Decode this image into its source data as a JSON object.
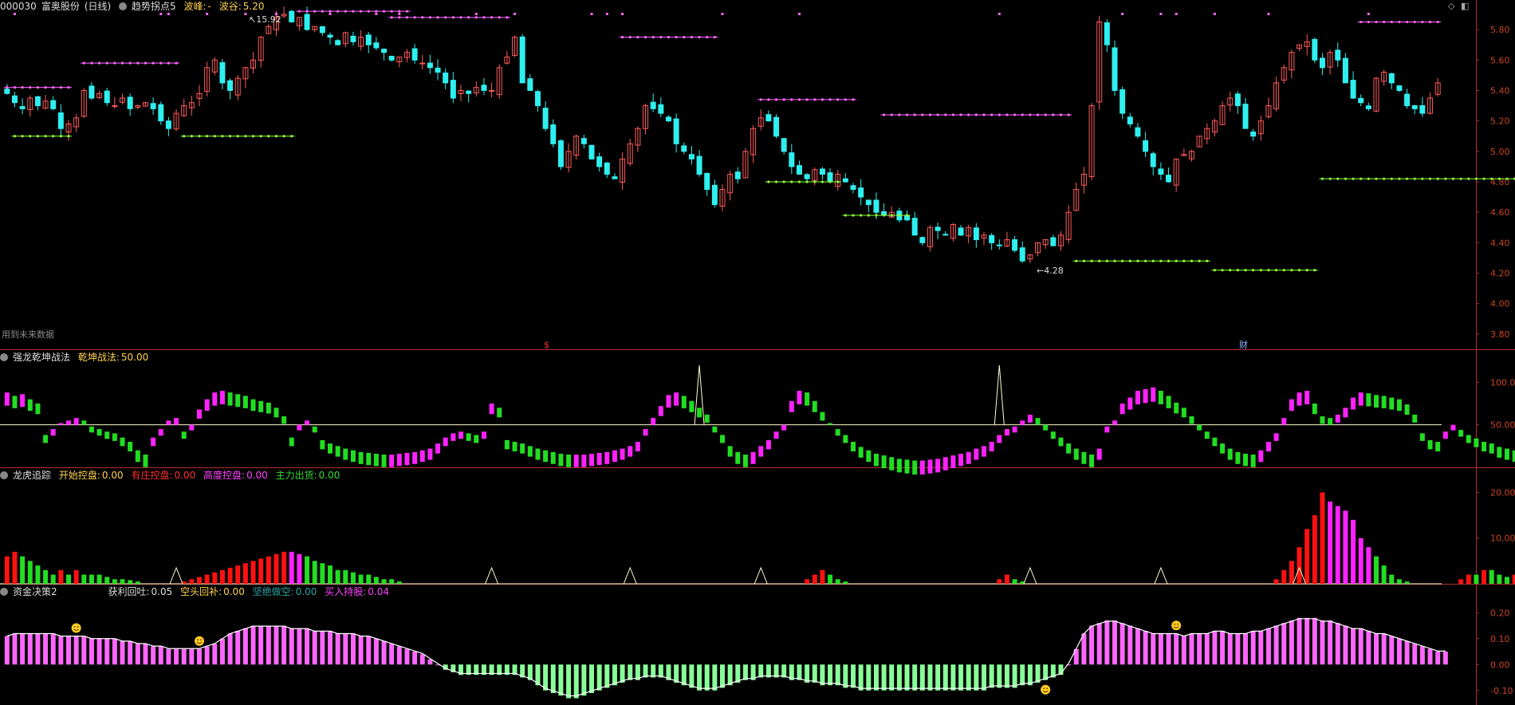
{
  "colors": {
    "up": "#ff5a5a",
    "down": "#2ff0f0",
    "resistance": "#ff66ff",
    "support": "#8dff3a",
    "ma": "#ffffcc",
    "green_bar": "#22dd22",
    "magenta_bar": "#ff22ff",
    "red_bar": "#ff1111",
    "light_green_bar": "#88ff99",
    "pink_bar": "#ff66ff",
    "axis": "#b03030"
  },
  "panel1": {
    "code": "000030",
    "name": "富奥股份",
    "period": "(日线)",
    "indicator": "趋势拐点5",
    "peak_label": "波峰:",
    "peak_value": "-",
    "valley_label": "波谷:",
    "valley_value": "5.20",
    "future_data_note": "用到未来数据",
    "s_marker": "$",
    "cai_marker": "财",
    "high_annotation": "15.92",
    "low_annotation": "4.28"
  },
  "panel2": {
    "name": "强龙乾坤战法",
    "field_label": "乾坤战法:",
    "field_value": "50.00"
  },
  "panel3": {
    "name": "龙虎追踪",
    "f1_label": "开始控盘:",
    "f1_value": "0.00",
    "f2_label": "有庄控盘:",
    "f2_value": "0.00",
    "f3_label": "高度控盘:",
    "f3_value": "0.00",
    "f4_label": "主力出货:",
    "f4_value": "0.00"
  },
  "panel4": {
    "name": "资金决策2",
    "f1_label": "获利回吐:",
    "f1_value": "0.05",
    "f2_label": "空头回补:",
    "f2_value": "0.00",
    "f3_label": "坚绝做空:",
    "f3_value": "0.00",
    "f4_label": "买入持股:",
    "f4_value": "0.04"
  },
  "chart_data": [
    {
      "type": "candlestick",
      "panel": "price",
      "ylim": [
        3.7,
        5.9
      ],
      "y_ticks": [
        "5.80",
        "5.60",
        "5.40",
        "5.20",
        "5.00",
        "4.80",
        "4.60",
        "4.40",
        "4.20",
        "4.00",
        "3.80"
      ],
      "close": [
        5.38,
        5.32,
        5.28,
        5.35,
        5.3,
        5.33,
        5.28,
        5.15,
        5.18,
        5.22,
        5.4,
        5.35,
        5.38,
        5.32,
        5.3,
        5.35,
        5.28,
        5.3,
        5.32,
        5.28,
        5.2,
        5.15,
        5.25,
        5.3,
        5.32,
        5.38,
        5.55,
        5.6,
        5.45,
        5.4,
        5.48,
        5.55,
        5.6,
        5.75,
        5.82,
        5.88,
        5.9,
        5.85,
        5.88,
        5.8,
        5.82,
        5.78,
        5.75,
        5.7,
        5.78,
        5.72,
        5.75,
        5.7,
        5.68,
        5.65,
        5.6,
        5.62,
        5.65,
        5.6,
        5.58,
        5.55,
        5.52,
        5.45,
        5.35,
        5.4,
        5.38,
        5.42,
        5.4,
        5.4,
        5.55,
        5.62,
        5.75,
        5.45,
        5.4,
        5.3,
        5.15,
        5.05,
        4.9,
        5.0,
        5.1,
        5.05,
        4.95,
        4.9,
        4.85,
        4.82,
        4.95,
        5.05,
        5.15,
        5.3,
        5.28,
        5.25,
        5.2,
        5.05,
        5.0,
        4.95,
        4.85,
        4.75,
        4.65,
        4.75,
        4.85,
        4.82,
        5.0,
        5.15,
        5.22,
        5.2,
        5.1,
        5.0,
        4.9,
        4.85,
        4.82,
        4.88,
        4.85,
        4.8,
        4.85,
        4.8,
        4.75,
        4.7,
        4.65,
        4.6,
        4.58,
        4.6,
        4.55,
        4.55,
        4.45,
        4.4,
        4.5,
        4.48,
        4.45,
        4.52,
        4.45,
        4.5,
        4.42,
        4.45,
        4.4,
        4.38,
        4.42,
        4.35,
        4.28,
        4.32,
        4.4,
        4.42,
        4.38,
        4.45,
        4.6,
        4.75,
        4.85,
        5.3,
        5.85,
        5.7,
        5.4,
        5.25,
        5.18,
        5.1,
        5.0,
        4.9,
        4.85,
        4.8,
        4.95,
        4.98,
        5.0,
        5.1,
        5.15,
        5.2,
        5.3,
        5.35,
        5.3,
        5.15,
        5.1,
        5.2,
        5.3,
        5.45,
        5.55,
        5.65,
        5.7,
        5.72,
        5.6,
        5.55,
        5.65,
        5.6,
        5.45,
        5.35,
        5.32,
        5.28,
        5.48,
        5.52,
        5.45,
        5.4,
        5.3,
        5.28,
        5.25,
        5.35,
        5.45
      ],
      "support_levels": [
        5.1,
        5.1,
        4.8,
        4.58,
        4.28,
        4.22,
        4.82,
        5.2
      ],
      "resistance_levels": [
        5.42,
        5.58,
        5.92,
        5.88,
        5.75,
        5.34,
        5.24,
        5.85,
        5.78
      ],
      "annotations": [
        "15.92",
        "4.28"
      ]
    },
    {
      "type": "bar",
      "panel": "强龙乾坤战法",
      "ylim": [
        0,
        120
      ],
      "y_ticks": [
        "100.0",
        "50.00"
      ],
      "baseline": 50,
      "values": [
        88,
        84,
        86,
        80,
        75,
        38,
        45,
        52,
        55,
        58,
        55,
        48,
        45,
        42,
        40,
        35,
        30,
        20,
        15,
        35,
        45,
        55,
        58,
        42,
        50,
        68,
        80,
        88,
        90,
        88,
        86,
        84,
        80,
        78,
        76,
        70,
        60,
        35,
        50,
        55,
        48,
        32,
        28,
        25,
        22,
        20,
        18,
        17,
        16,
        15,
        15,
        16,
        17,
        18,
        20,
        22,
        28,
        35,
        40,
        42,
        40,
        38,
        42,
        75,
        70,
        32,
        30,
        28,
        25,
        22,
        20,
        18,
        16,
        15,
        15,
        15,
        16,
        17,
        18,
        20,
        22,
        25,
        30,
        45,
        58,
        72,
        85,
        88,
        84,
        78,
        70,
        62,
        48,
        38,
        25,
        18,
        15,
        18,
        25,
        32,
        42,
        50,
        78,
        90,
        88,
        78,
        65,
        52,
        45,
        38,
        30,
        24,
        20,
        16,
        14,
        12,
        10,
        9,
        8,
        8,
        9,
        10,
        12,
        14,
        16,
        18,
        22,
        25,
        30,
        38,
        45,
        48,
        55,
        62,
        58,
        50,
        42,
        35,
        28,
        22,
        18,
        15,
        22,
        48,
        55,
        75,
        82,
        90,
        92,
        94,
        90,
        84,
        76,
        70,
        60,
        50,
        42,
        35,
        28,
        22,
        18,
        16,
        15,
        20,
        30,
        40,
        58,
        80,
        88,
        90,
        75,
        60,
        58,
        62,
        70,
        82,
        88,
        87,
        85,
        84,
        82,
        80,
        74,
        62,
        40,
        32,
        30,
        42,
        50,
        44,
        38,
        34,
        30,
        28,
        24,
        22,
        20,
        18,
        16,
        16,
        30,
        45,
        58,
        72
      ]
    },
    {
      "type": "bar",
      "panel": "龙虎追踪",
      "ylim": [
        0,
        22
      ],
      "y_ticks": [
        "20.00",
        "10.00"
      ],
      "values": [
        6,
        7,
        6,
        5,
        4,
        3,
        2,
        3,
        2,
        3,
        2,
        2,
        2,
        1.5,
        1,
        1,
        0.8,
        0.5,
        0,
        0,
        0,
        0,
        0,
        0.5,
        1,
        1.5,
        2,
        2.5,
        3,
        3.5,
        4,
        4.5,
        5,
        5.5,
        6,
        6.5,
        7,
        7,
        6.5,
        6,
        5,
        4.5,
        4,
        3,
        3,
        2.5,
        2,
        2,
        1.5,
        1,
        1,
        0.5,
        0,
        0,
        0,
        0,
        0,
        0,
        0,
        0,
        0,
        0,
        0,
        0,
        0,
        0,
        0,
        0,
        0,
        0,
        0,
        0,
        0,
        0,
        0,
        0,
        0,
        0,
        0,
        0,
        0,
        0,
        0,
        0,
        0,
        0,
        0,
        0,
        0,
        0,
        0,
        0,
        0,
        0,
        0,
        0,
        0,
        0,
        0,
        0,
        0,
        0,
        0,
        0,
        1,
        2,
        3,
        2,
        1,
        0.5,
        0,
        0,
        0,
        0,
        0,
        0,
        0,
        0,
        0,
        0,
        0,
        0,
        0,
        0,
        0,
        0,
        0,
        0,
        0,
        1,
        2,
        1,
        0.5,
        0,
        0,
        0,
        0,
        0,
        0,
        0,
        0,
        0,
        0,
        0,
        0,
        0,
        0,
        0,
        0,
        0,
        0,
        0,
        0,
        0,
        0,
        0,
        0,
        0,
        0,
        0,
        0,
        0,
        0,
        0,
        0,
        1,
        3,
        5,
        8,
        12,
        15,
        20,
        18,
        17,
        16,
        14,
        10,
        8,
        6,
        4,
        2,
        1,
        0.5,
        0,
        0,
        0,
        0,
        0,
        0,
        1,
        2,
        2,
        3,
        3,
        2,
        1.5,
        2,
        3,
        4,
        5,
        6,
        7,
        8,
        8,
        7,
        6,
        5,
        3,
        2,
        1,
        0,
        0,
        0,
        0
      ],
      "triangles_at": [
        22,
        63,
        81,
        98,
        133,
        150,
        168
      ],
      "series": [
        {
          "name": "开始控盘"
        },
        {
          "name": "有庄控盘"
        },
        {
          "name": "高度控盘"
        },
        {
          "name": "主力出货"
        }
      ]
    },
    {
      "type": "bar",
      "panel": "资金决策2",
      "ylim": [
        -0.15,
        0.25
      ],
      "y_ticks": [
        "0.20",
        "0.10",
        "0.00",
        "-0.10"
      ],
      "values": [
        0.11,
        0.12,
        0.12,
        0.12,
        0.12,
        0.12,
        0.12,
        0.11,
        0.11,
        0.11,
        0.11,
        0.1,
        0.1,
        0.1,
        0.1,
        0.09,
        0.09,
        0.08,
        0.08,
        0.07,
        0.07,
        0.06,
        0.06,
        0.06,
        0.06,
        0.06,
        0.07,
        0.08,
        0.1,
        0.12,
        0.13,
        0.14,
        0.15,
        0.15,
        0.15,
        0.15,
        0.15,
        0.14,
        0.14,
        0.14,
        0.13,
        0.13,
        0.13,
        0.12,
        0.12,
        0.12,
        0.11,
        0.11,
        0.1,
        0.09,
        0.08,
        0.07,
        0.06,
        0.05,
        0.04,
        0.02,
        0.0,
        -0.02,
        -0.03,
        -0.04,
        -0.04,
        -0.04,
        -0.04,
        -0.04,
        -0.04,
        -0.04,
        -0.04,
        -0.05,
        -0.06,
        -0.08,
        -0.1,
        -0.11,
        -0.12,
        -0.13,
        -0.13,
        -0.12,
        -0.11,
        -0.1,
        -0.09,
        -0.08,
        -0.07,
        -0.06,
        -0.06,
        -0.05,
        -0.05,
        -0.05,
        -0.06,
        -0.07,
        -0.08,
        -0.09,
        -0.1,
        -0.1,
        -0.1,
        -0.09,
        -0.08,
        -0.07,
        -0.06,
        -0.06,
        -0.05,
        -0.05,
        -0.05,
        -0.05,
        -0.06,
        -0.06,
        -0.07,
        -0.07,
        -0.08,
        -0.08,
        -0.08,
        -0.09,
        -0.09,
        -0.1,
        -0.1,
        -0.1,
        -0.1,
        -0.1,
        -0.1,
        -0.1,
        -0.1,
        -0.1,
        -0.1,
        -0.1,
        -0.1,
        -0.1,
        -0.1,
        -0.1,
        -0.1,
        -0.1,
        -0.09,
        -0.09,
        -0.09,
        -0.09,
        -0.08,
        -0.08,
        -0.07,
        -0.06,
        -0.05,
        -0.04,
        0.0,
        0.06,
        0.12,
        0.15,
        0.16,
        0.17,
        0.17,
        0.16,
        0.15,
        0.14,
        0.13,
        0.12,
        0.12,
        0.12,
        0.12,
        0.11,
        0.12,
        0.12,
        0.12,
        0.13,
        0.13,
        0.12,
        0.12,
        0.12,
        0.13,
        0.13,
        0.14,
        0.15,
        0.16,
        0.17,
        0.18,
        0.18,
        0.18,
        0.17,
        0.17,
        0.16,
        0.15,
        0.14,
        0.14,
        0.13,
        0.12,
        0.12,
        0.11,
        0.1,
        0.09,
        0.08,
        0.07,
        0.06,
        0.05,
        0.05
      ],
      "smile_markers_at": [
        9,
        25,
        135,
        152
      ]
    }
  ]
}
